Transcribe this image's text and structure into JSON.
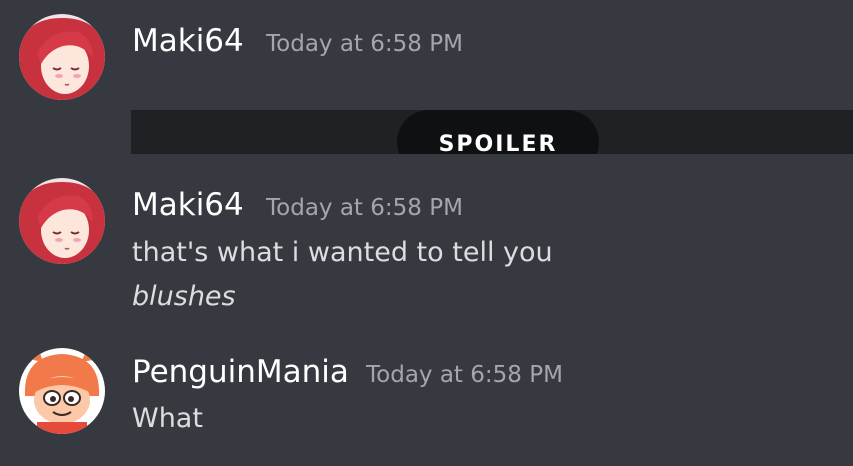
{
  "messages": [
    {
      "author": "Maki64",
      "timestamp": "Today at 6:58 PM",
      "avatar": "red-haired-anime-girl-avatar",
      "spoiler_label": "SPOILER"
    },
    {
      "author": "Maki64",
      "timestamp": "Today at 6:58 PM",
      "avatar": "red-haired-anime-girl-avatar",
      "lines": [
        "that's what i wanted to tell you",
        "blushes"
      ]
    },
    {
      "author": "PenguinMania",
      "timestamp": "Today at 6:58 PM",
      "avatar": "orange-cartoon-character-avatar",
      "lines": [
        "What"
      ]
    }
  ],
  "colors": {
    "background": "#36393f",
    "author": "#ffffff",
    "timestamp": "#a3a6aa",
    "message_text": "#dcddde",
    "spoiler_bar": "#1f2124",
    "spoiler_pill": "#0f1012"
  }
}
